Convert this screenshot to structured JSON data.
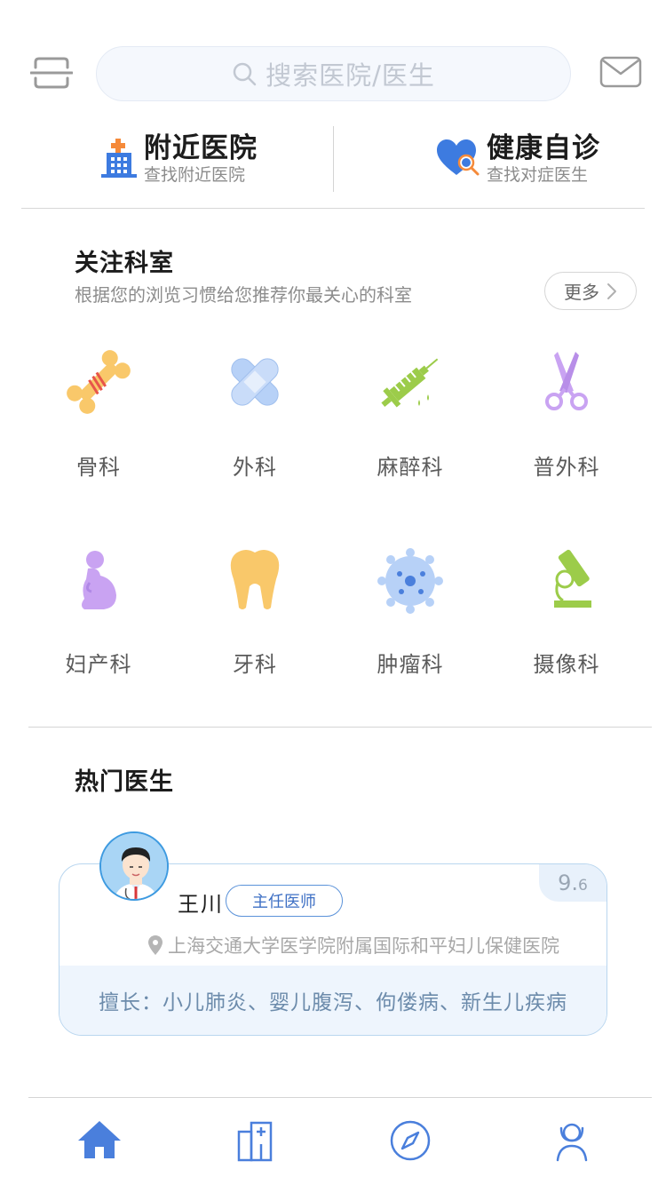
{
  "search": {
    "placeholder": "搜索医院/医生"
  },
  "icons": {
    "scan": "scan-icon",
    "mail": "mail-icon",
    "search": "search-icon"
  },
  "quick_entries": [
    {
      "title": "附近医院",
      "subtitle": "查找附近医院",
      "icon": "hospital-icon"
    },
    {
      "title": "健康自诊",
      "subtitle": "查找对症医生",
      "icon": "heart-search-icon"
    }
  ],
  "departments": {
    "title": "关注科室",
    "subtitle": "根据您的浏览习惯给您推荐你最关心的科室",
    "more_label": "更多",
    "items": [
      {
        "label": "骨科",
        "icon": "bone-icon"
      },
      {
        "label": "外科",
        "icon": "bandage-icon"
      },
      {
        "label": "麻醉科",
        "icon": "syringe-icon"
      },
      {
        "label": "普外科",
        "icon": "scissors-icon"
      },
      {
        "label": "妇产科",
        "icon": "pregnant-icon"
      },
      {
        "label": "牙科",
        "icon": "tooth-icon"
      },
      {
        "label": "肿瘤科",
        "icon": "cell-icon"
      },
      {
        "label": "摄像科",
        "icon": "microscope-icon"
      }
    ]
  },
  "hot_doctors": {
    "title": "热门医生",
    "doctor": {
      "name": "王川",
      "title": "主任医师",
      "score_main": "9.",
      "score_decimal": "6",
      "hospital": "上海交通大学医学院附属国际和平妇儿保健医院",
      "specialty": "擅长：小儿肺炎、婴儿腹泻、佝偻病、新生儿疾病"
    }
  },
  "tabbar": [
    {
      "name": "home",
      "icon": "home-icon"
    },
    {
      "name": "hospital",
      "icon": "hospital-building-icon"
    },
    {
      "name": "discover",
      "icon": "compass-icon"
    },
    {
      "name": "profile",
      "icon": "user-icon"
    }
  ],
  "colors": {
    "accent": "#4a7fdc",
    "bone": "#f9c86a",
    "purple": "#c9a3f2",
    "green": "#9ccc4a",
    "blue_light": "#b7d1f7"
  }
}
